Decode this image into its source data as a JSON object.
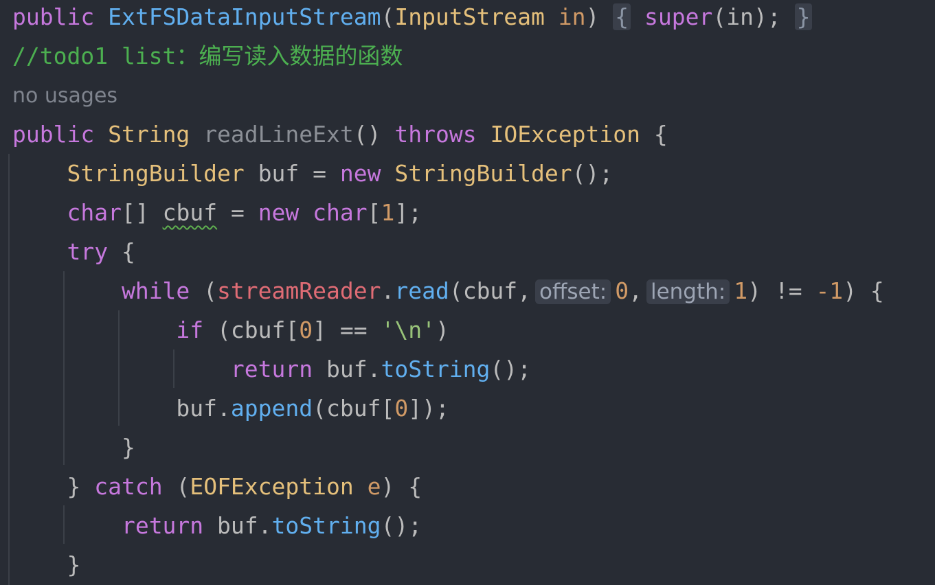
{
  "editor": {
    "line_constructor": {
      "kw_public": "public",
      "ctor_name": "ExtFSDataInputStream",
      "open_paren": "(",
      "param_type": "InputStream",
      "param_name": "in",
      "close_paren": ")",
      "fold_open": "{",
      "super_kw": "super",
      "super_args": "(in);",
      "fold_close": "}"
    },
    "comment": "//todo1 list：编写读入数据的函数",
    "usage_hint": "no usages",
    "line_sig": {
      "kw_public": "public",
      "ret_type": "String",
      "method_name": "readLineExt",
      "parens": "()",
      "kw_throws": "throws",
      "exc_type": "IOException",
      "brace": "{"
    },
    "line_buf": {
      "type": "StringBuilder",
      "rest1": "buf = ",
      "kw_new": "new",
      "ctor": "StringBuilder",
      "rest2": "();"
    },
    "line_cbuf": {
      "type": "char",
      "brackets": "[]",
      "var": "cbuf",
      "eq": " = ",
      "kw_new": "new",
      "type2": "char",
      "open": "[",
      "num": "1",
      "close": "];"
    },
    "line_try": {
      "kw": "try",
      "brace": "{"
    },
    "line_while": {
      "kw": "while",
      "open": "(",
      "field": "streamReader",
      "dot": ".",
      "method": "read",
      "args_start": "(cbuf,",
      "hint_offset": "offset:",
      "num_offset": "0",
      "comma": ",",
      "hint_length": "length:",
      "num_length": "1",
      "cmp": ") != ",
      "num_neg": "-1",
      "end": ") {"
    },
    "line_if": {
      "kw": "if",
      "cond1": "(cbuf[",
      "num": "0",
      "cond2": "] == ",
      "char_lit": "'\\n'",
      "close": ")"
    },
    "line_return1": {
      "kw": "return",
      "obj": "buf.",
      "method": "toString",
      "end": "();"
    },
    "line_append": {
      "obj": "buf.",
      "method": "append",
      "arg1": "(cbuf[",
      "num": "0",
      "arg2": "]);"
    },
    "line_close_while": "}",
    "line_catch": {
      "brace": "}",
      "kw": "catch",
      "open": "(",
      "exc_type": "EOFException",
      "param": "e",
      "end": ") {"
    },
    "line_return2": {
      "kw": "return",
      "obj": "buf.",
      "method": "toString",
      "end": "();"
    },
    "line_close_catch": "}"
  }
}
